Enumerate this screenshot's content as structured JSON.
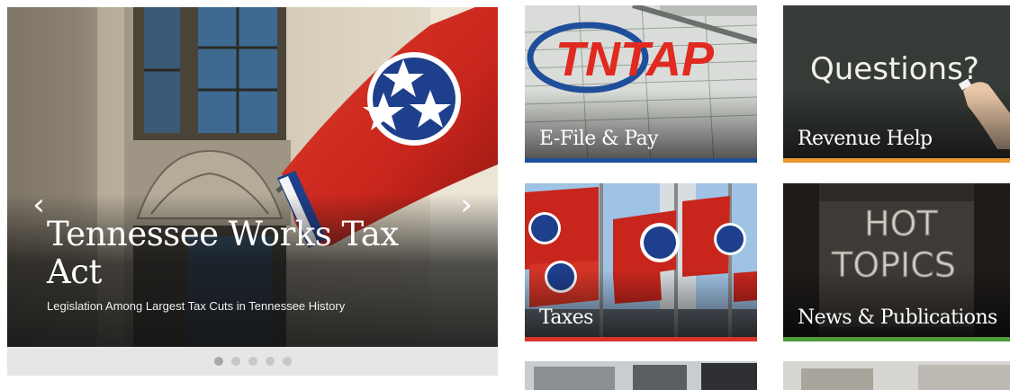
{
  "carousel": {
    "title": "Tennessee Works Tax Act",
    "subtitle": "Legislation Among Largest Tax Cuts in Tennessee History",
    "prev_arrow": "‹",
    "next_arrow": "›",
    "slide_count": 5,
    "active_slide": 1
  },
  "tiles": {
    "efile": {
      "label": "E-File & Pay",
      "logo_text": "TNTAP",
      "bar_color": "#1f4e9a"
    },
    "help": {
      "label": "Revenue Help",
      "chalk_text": "Questions?",
      "bar_color": "#e8962e"
    },
    "taxes": {
      "label": "Taxes",
      "bar_color": "#d9342b"
    },
    "news": {
      "label": "News & Publications",
      "letters_line1": "HOT",
      "letters_line2": "TOPICS",
      "bar_color": "#4f9a3a"
    }
  },
  "colors": {
    "flag_red": "#c8261c",
    "flag_blue": "#1e3f8c",
    "chalkboard": "#2f3430"
  }
}
